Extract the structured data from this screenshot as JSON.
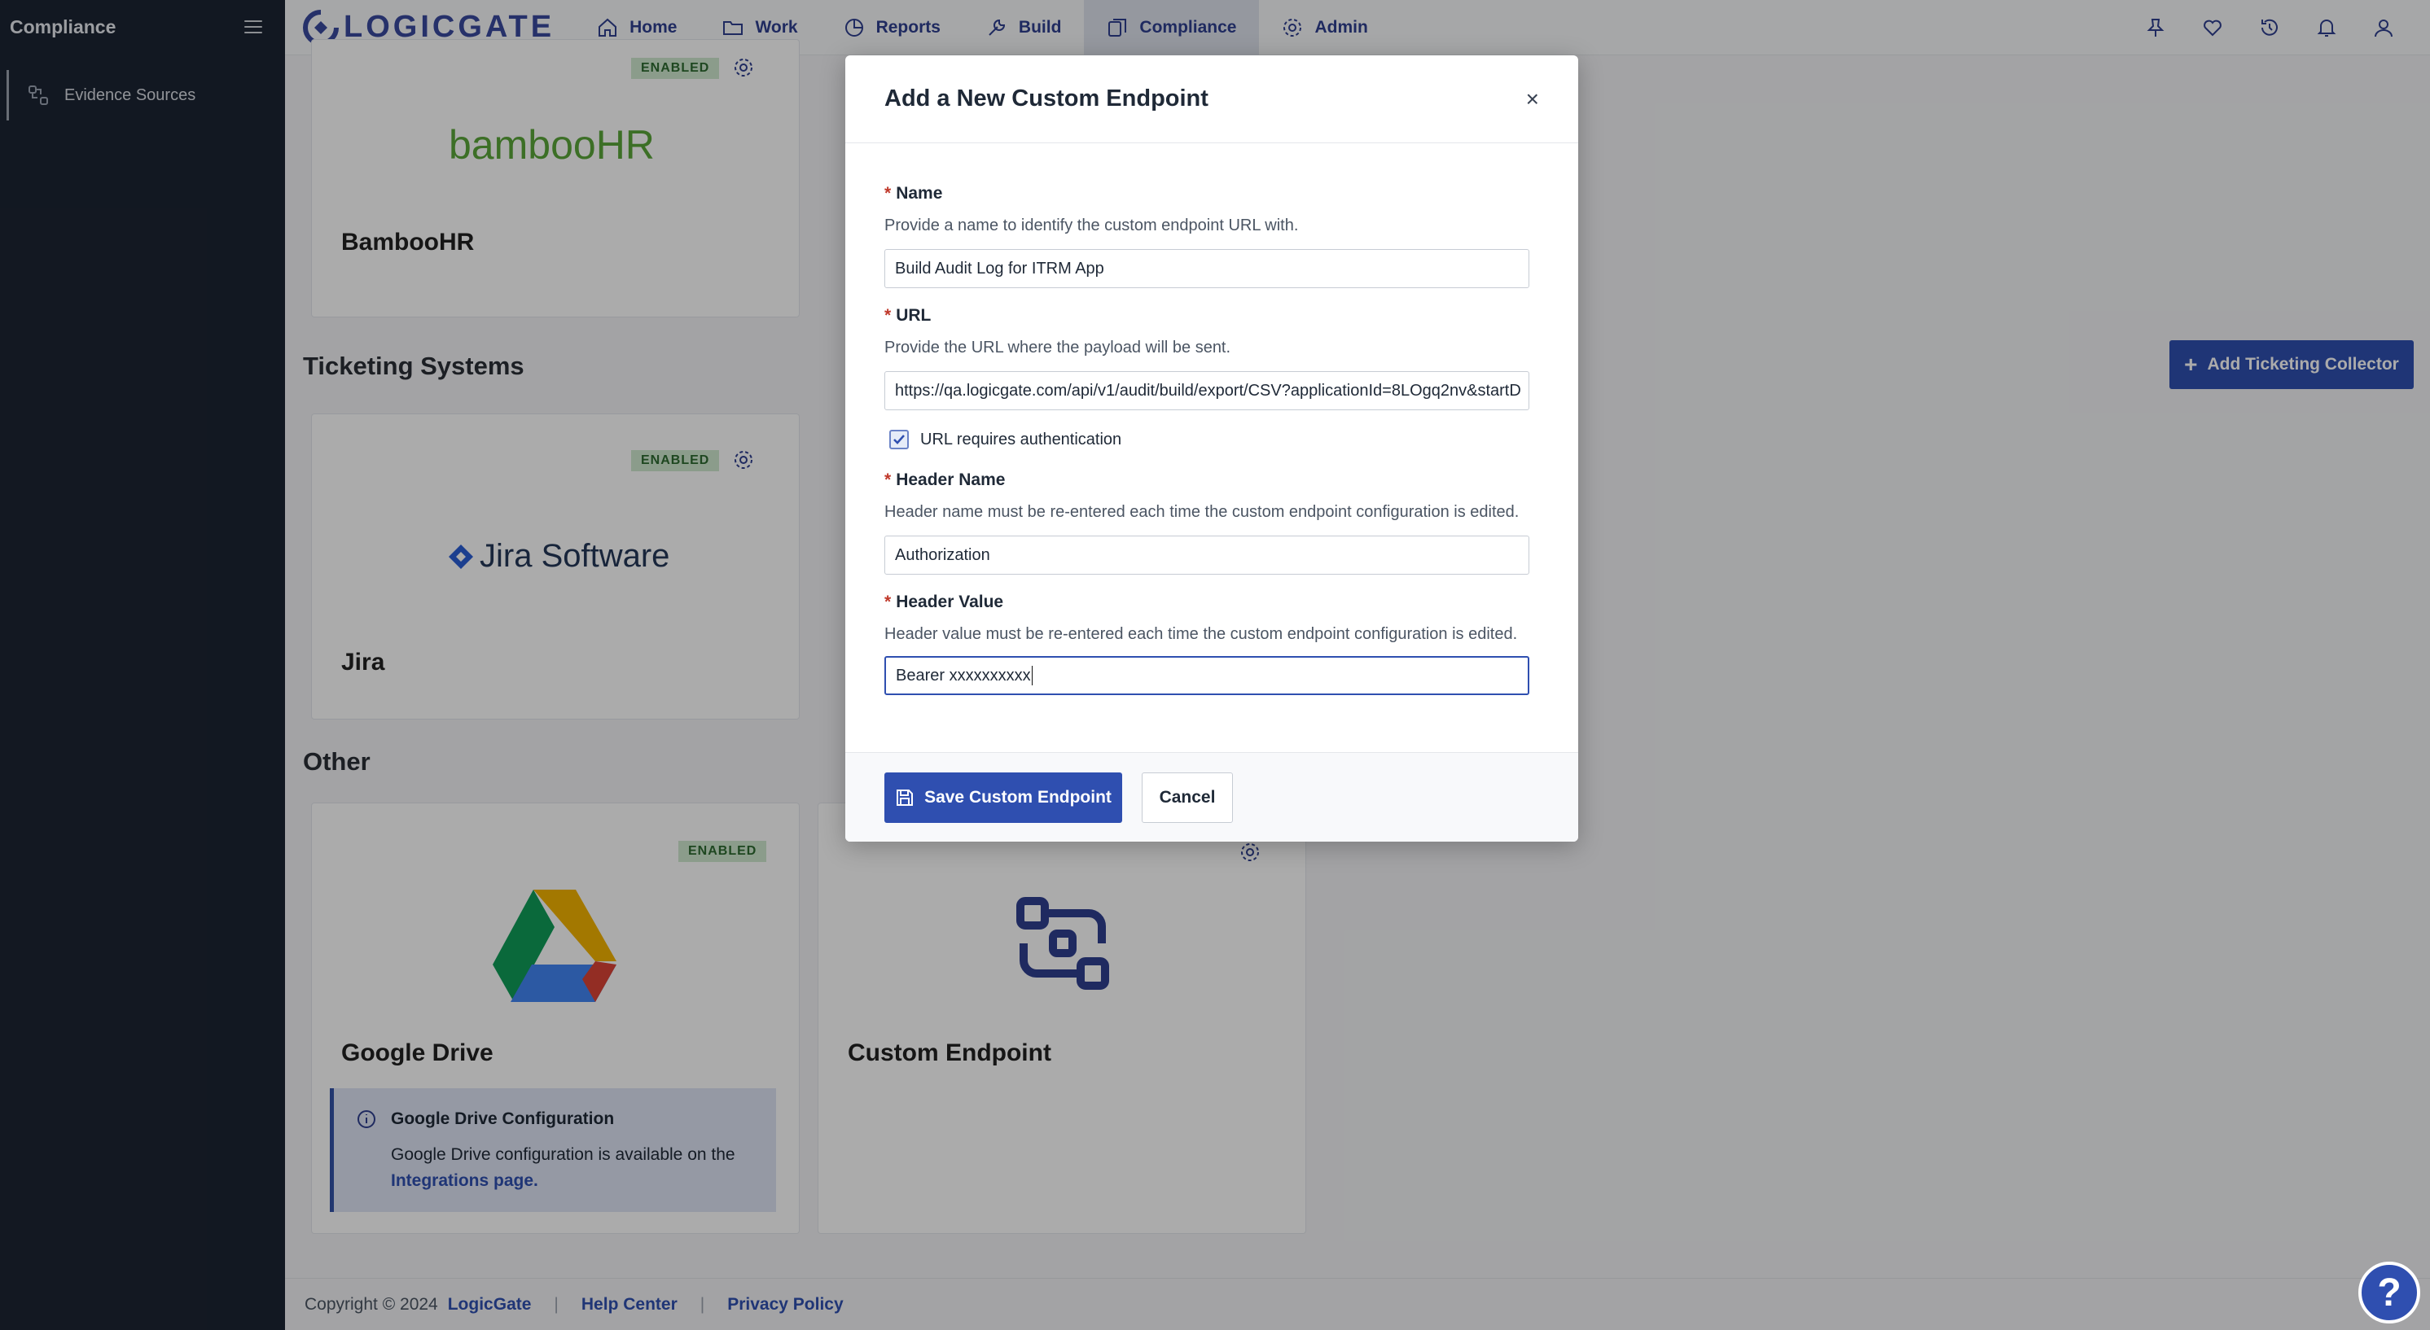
{
  "sidebar": {
    "title": "Compliance",
    "items": [
      {
        "label": "Evidence Sources",
        "icon": "evidence-icon"
      }
    ]
  },
  "topbar": {
    "logo_text": "LOGICGATE",
    "nav": [
      {
        "label": "Home",
        "icon": "home-icon"
      },
      {
        "label": "Work",
        "icon": "folder-icon"
      },
      {
        "label": "Reports",
        "icon": "reports-icon"
      },
      {
        "label": "Build",
        "icon": "wrench-icon"
      },
      {
        "label": "Compliance",
        "icon": "compliance-icon",
        "active": true
      },
      {
        "label": "Admin",
        "icon": "gear-icon"
      }
    ],
    "right_icons": [
      "pin-icon",
      "heart-icon",
      "history-icon",
      "bell-icon",
      "user-icon"
    ]
  },
  "content": {
    "cards": {
      "bamboo": {
        "title": "BambooHR",
        "badge": "ENABLED",
        "logo": "bambooHR"
      },
      "jira": {
        "title": "Jira",
        "badge": "ENABLED",
        "logo": "Jira Software"
      },
      "gdrive": {
        "title": "Google Drive",
        "badge": "ENABLED"
      },
      "custom": {
        "title": "Custom Endpoint"
      }
    },
    "sections": {
      "ticketing": "Ticketing Systems",
      "other": "Other"
    },
    "add_ticketing_label": "Add Ticketing Collector",
    "info": {
      "title": "Google Drive Configuration",
      "text": "Google Drive configuration is available on the",
      "link": "Integrations page."
    }
  },
  "footer": {
    "copyright": "Copyright © 2024",
    "brand": "LogicGate",
    "help": "Help Center",
    "privacy": "Privacy Policy"
  },
  "modal": {
    "title": "Add a New Custom Endpoint",
    "close": "×",
    "name": {
      "label": "Name",
      "help": "Provide a name to identify the custom endpoint URL with.",
      "value": "Build Audit Log for ITRM App"
    },
    "url": {
      "label": "URL",
      "help": "Provide the URL where the payload will be sent.",
      "value": "https://qa.logicgate.com/api/v1/audit/build/export/CSV?applicationId=8LOgq2nv&startD"
    },
    "auth": {
      "label": "URL requires authentication",
      "checked": true
    },
    "header_name": {
      "label": "Header Name",
      "help": "Header name must be re-entered each time the custom endpoint configuration is edited.",
      "value": "Authorization"
    },
    "header_value": {
      "label": "Header Value",
      "help": "Header value must be re-entered each time the custom endpoint configuration is edited.",
      "value": "Bearer xxxxxxxxxx"
    },
    "save_label": "Save Custom Endpoint",
    "cancel_label": "Cancel",
    "required_mark": "*"
  },
  "help_fab": "?",
  "colors": {
    "primary": "#2f4fb0",
    "sidebar": "#1c2433",
    "badge_bg": "#cfe9d0",
    "badge_text": "#2d6a31"
  }
}
